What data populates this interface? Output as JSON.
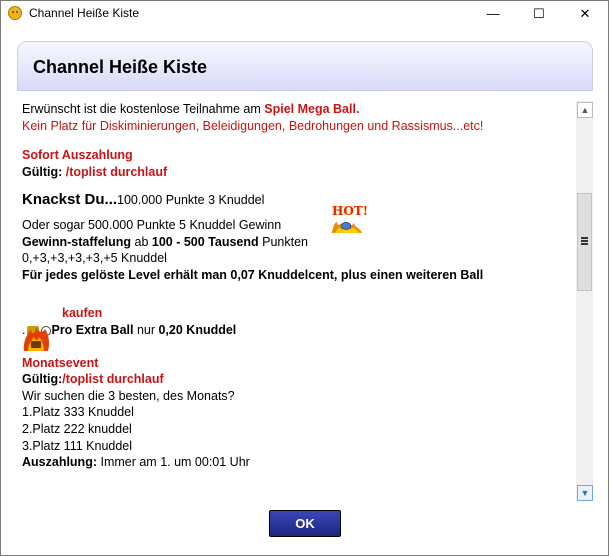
{
  "window": {
    "title": "Channel Heiße Kiste",
    "min_label": "—",
    "max_label": "☐",
    "close_label": "✕"
  },
  "dialog": {
    "header": "Channel Heiße Kiste",
    "ok_label": "OK"
  },
  "content": {
    "l1_pre": "Erwünscht ist die kostenlose Teilnahme am ",
    "l1_red": "Spiel Mega Ball.",
    "l2": "Kein Platz für Diskiminierungen, Beleidigungen, Bedrohungen und Rassismus...etc!",
    "l3": "Sofort Auszahlung",
    "l4_label": "Gültig: ",
    "l4_red": "/toplist durchlauf",
    "l5_big": "Knackst Du...",
    "l5_rest": "100.000 Punkte 3 Knuddel",
    "l6": "Oder sogar 500.000 Punkte 5 Knuddel Gewinn",
    "hot_label": "HOT!",
    "l7_a": "Gewinn-staffelung",
    "l7_b": " ab ",
    "l7_c": "100 - 500 Tausend",
    "l7_d": " Punkten",
    "l8": "0,+3,+3,+3,+3,+5 Knuddel",
    "l9": "Für jedes gelöste Level erhält man 0,07 Knuddelcent, plus einen weiteren Ball",
    "l10": "kaufen",
    "l11_pre": ".",
    "l11_a": "Pro Extra Ball",
    "l11_b": " nur ",
    "l11_c": "0,20 Knuddel",
    "l12": "Monatsevent",
    "l13_label": "Gültig:",
    "l13_red": "/toplist durchlauf",
    "l14": "Wir suchen die 3 besten, des Monats?",
    "l15": "1.Platz 333 Knuddel",
    "l16": "2.Platz 222 knuddel",
    "l17": "3.Platz 111 Knuddel",
    "l18_a": "Auszahlung:",
    "l18_b": " Immer am 1. um 00:01 Uhr"
  },
  "scrollbar": {
    "up": "▲",
    "down": "▼"
  },
  "colors": {
    "accent_red": "#c81414",
    "button_blue": "#1c2580"
  }
}
